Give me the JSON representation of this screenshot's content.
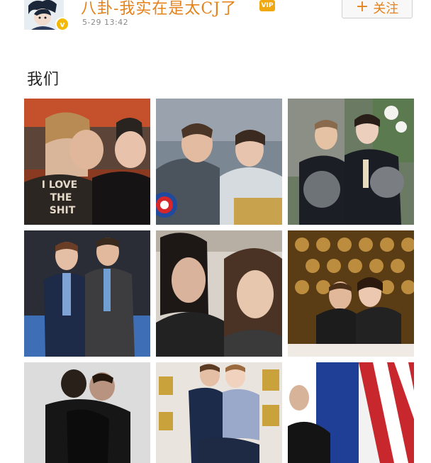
{
  "post": {
    "username": "八卦-我实在是太CJ了",
    "vip_badge": "VIP",
    "verified_badge": "v",
    "timestamp": "5-29 13:42",
    "follow_button": {
      "icon": "+",
      "label": "关注"
    },
    "text": "我们"
  },
  "photos": [
    {
      "caption": "I LOVE THE SHIT",
      "colors": {
        "bg": "#c5502c",
        "bg2": "#3a2f2c"
      }
    },
    {
      "caption": "",
      "colors": {
        "bg": "#6f7a86",
        "bg2": "#cfd5da"
      }
    },
    {
      "caption": "",
      "colors": {
        "bg": "#5d6c55",
        "bg2": "#e9e5e0"
      }
    },
    {
      "caption": "",
      "colors": {
        "bg": "#3a4c70",
        "bg2": "#1f2735"
      }
    },
    {
      "caption": "",
      "colors": {
        "bg": "#6e6358",
        "bg2": "#e6e2dd"
      }
    },
    {
      "caption": "",
      "colors": {
        "bg": "#6a4e1e",
        "bg2": "#d6a24a"
      }
    },
    {
      "caption": "",
      "colors": {
        "bg": "#d9d9d9",
        "bg2": "#151515"
      }
    },
    {
      "caption": "",
      "colors": {
        "bg": "#e7e2dc",
        "bg2": "#1b2b49"
      }
    },
    {
      "caption": "",
      "colors": {
        "bg": "#1f3f96",
        "bg2": "#c8282d"
      }
    }
  ]
}
